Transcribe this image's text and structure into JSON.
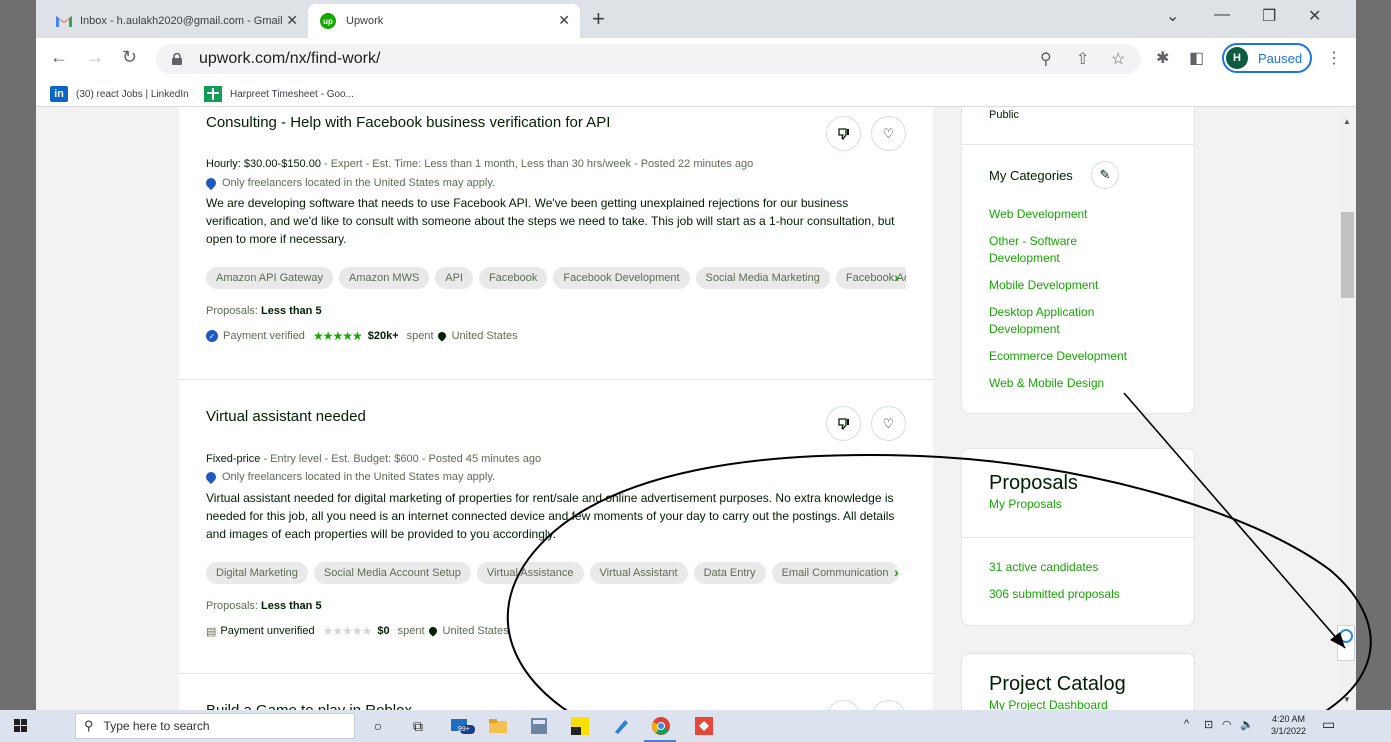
{
  "tabs": [
    {
      "title": "Inbox - h.aulakh2020@gmail.com - Gmail",
      "close": "✕"
    },
    {
      "title": "Upwork",
      "close": "✕"
    }
  ],
  "window": {
    "new_tab": "+",
    "collapse": "⌄",
    "minimize": "—",
    "restore": "❐",
    "close": "✕"
  },
  "toolbar": {
    "url": "upwork.com/nx/find-work/",
    "profile_initial": "H",
    "profile_label": "Paused"
  },
  "bookmarks": [
    {
      "label": "(30) react Jobs | LinkedIn",
      "icon": "in"
    },
    {
      "label": "Harpreet Timesheet - Goo..."
    }
  ],
  "jobs": [
    {
      "title": "Consulting - Help with Facebook business verification for API",
      "meta_type": "Hourly: $30.00-$150.00",
      "meta_rest": " - Expert - Est. Time: Less than 1 month, Less than 30 hrs/week - Posted 22 minutes ago",
      "location_note": "Only freelancers located in the United States may apply.",
      "description": "We are developing software that needs to use Facebook API. We've been getting unexplained rejections for our business verification, and we'd like to consult with someone about the steps we need to take. This job will start as a 1-hour consultation, but open to more if necessary.",
      "skills": [
        "Amazon API Gateway",
        "Amazon MWS",
        "API",
        "Facebook",
        "Facebook Development",
        "Social Media Marketing",
        "Facebook Ads Manager"
      ],
      "proposals_label": "Proposals:",
      "proposals_value": "Less than 5",
      "payment_status": "Payment verified",
      "rating": 5,
      "spent": "$20k+",
      "spent_label": "spent",
      "country": "United States"
    },
    {
      "title": "Virtual assistant needed",
      "meta_type": "Fixed-price",
      "meta_rest": " - Entry level - Est. Budget: $600 - Posted 45 minutes ago",
      "location_note": "Only freelancers located in the United States may apply.",
      "description": "Virtual assistant needed for digital marketing of properties for rent/sale and online advertisement purposes. No extra knowledge is needed for this job, all you need is an internet connected device and few moments of your day to carry out the postings. All details and images of each properties will be provided to you accordingly.",
      "skills": [
        "Digital Marketing",
        "Social Media Account Setup",
        "Virtual Assistance",
        "Virtual Assistant",
        "Data Entry",
        "Email Communication"
      ],
      "proposals_label": "Proposals:",
      "proposals_value": "Less than 5",
      "payment_status": "Payment unverified",
      "rating": 0,
      "spent": "$0",
      "spent_label": "spent",
      "country": "United States"
    },
    {
      "title": "Build a Game to play in Roblox"
    }
  ],
  "sidebar": {
    "visibility": "Public",
    "categories_title": "My Categories",
    "categories": [
      "Web Development",
      "Other - Software Development",
      "Mobile Development",
      "Desktop Application Development",
      "Ecommerce Development",
      "Web & Mobile Design"
    ],
    "proposals_title": "Proposals",
    "proposals_link": "My Proposals",
    "active_candidates": "31 active candidates",
    "submitted_proposals": "306 submitted proposals",
    "catalog_title": "Project Catalog",
    "catalog_link": "My Project Dashboard"
  },
  "taskbar": {
    "search_placeholder": "Type here to search",
    "mail_badge": "99+",
    "time": "4:20 AM",
    "date": "3/1/2022"
  },
  "colors": {
    "upwork_green": "#14a800",
    "annotation": "#000000",
    "taskbar": "#dce3ef"
  }
}
